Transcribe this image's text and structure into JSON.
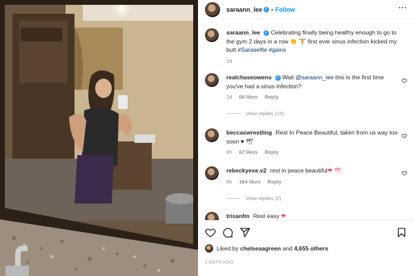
{
  "post": {
    "author": "saraann_lee",
    "follow_label": "Follow",
    "more_label": "···",
    "caption_segments": {
      "text1": "Celebrating finally being healthy enough to go to the gym 2 days in a row ",
      "emoji1": "👏 🏋",
      "text2": " first ever sinus infection kicked my butt ",
      "tag1": "#Saraselfie",
      "tag2": "#gains"
    },
    "caption_time": "2d",
    "liked_by_prefix": "Liked by ",
    "liked_by_user": "chelseaagreen",
    "liked_by_and": " and ",
    "liked_by_others": "4,655 others",
    "timestamp": "2 DAYS AGO"
  },
  "comments": [
    {
      "user": "realchaseowens",
      "verified": true,
      "text_prefix": "Wait ",
      "mention": "@saraann_lee",
      "text": " this is the first time you've had a sinus infection?",
      "time": "2d",
      "likes": "68 likes",
      "reply_label": "Reply",
      "view_replies": "View replies (15)"
    },
    {
      "user": "beccaxwrestling",
      "text": "Rest In Peace Beautiful, taken from us way too soon ♥ ",
      "emoji": "🕊",
      "time": "8h",
      "likes": "67 likes",
      "reply_label": "Reply"
    },
    {
      "user": "rebeckyexe.v2",
      "text": "rest in peace beautiful",
      "emoji": "❤ 🕊",
      "time": "8h",
      "likes": "164 likes",
      "reply_label": "Reply",
      "view_replies": "View replies (2)"
    },
    {
      "user": "trisanfm",
      "text": "Rest easy ",
      "emoji": "❤"
    }
  ],
  "icons": {
    "like": "heart-outline-icon",
    "comment": "comment-icon",
    "share": "paper-plane-icon",
    "save": "bookmark-icon",
    "verified": "verified-badge-icon"
  },
  "colors": {
    "link_blue": "#0095f6",
    "verified_blue": "#3897f0",
    "muted_gray": "#8e8e8e",
    "heart_red": "#ed4956"
  }
}
